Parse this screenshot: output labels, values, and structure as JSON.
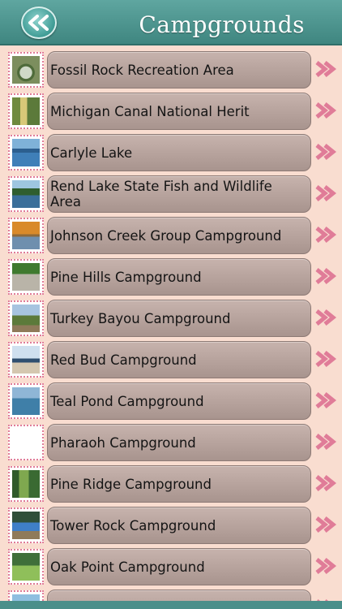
{
  "header": {
    "title": "Campgrounds",
    "back_icon": "double-chevron-left-icon"
  },
  "colors": {
    "header": "#4a8f8a",
    "list_background": "#f9ddd0",
    "pill": "#b8a49e",
    "chevron": "#e07c98"
  },
  "items": [
    {
      "label": "Fossil Rock Recreation Area",
      "thumb": "stone-arch"
    },
    {
      "label": "Michigan Canal National Herit",
      "thumb": "canal"
    },
    {
      "label": "Carlyle Lake",
      "thumb": "lake"
    },
    {
      "label": "Rend Lake State Fish and Wildlife Area",
      "thumb": "lake-trees"
    },
    {
      "label": "Johnson Creek Group Campground",
      "thumb": "autumn-lake"
    },
    {
      "label": "Pine Hills Campground",
      "thumb": "road"
    },
    {
      "label": "Turkey Bayou Campground",
      "thumb": "campsite"
    },
    {
      "label": "Red Bud Campground",
      "thumb": "shore"
    },
    {
      "label": "Teal Pond Campground",
      "thumb": "pond"
    },
    {
      "label": "Pharaoh Campground",
      "thumb": "blank"
    },
    {
      "label": "Pine Ridge Campground",
      "thumb": "forest"
    },
    {
      "label": "Tower Rock Campground",
      "thumb": "tent"
    },
    {
      "label": "Oak Point Campground",
      "thumb": "meadow"
    },
    {
      "label": "",
      "thumb": "water"
    }
  ]
}
